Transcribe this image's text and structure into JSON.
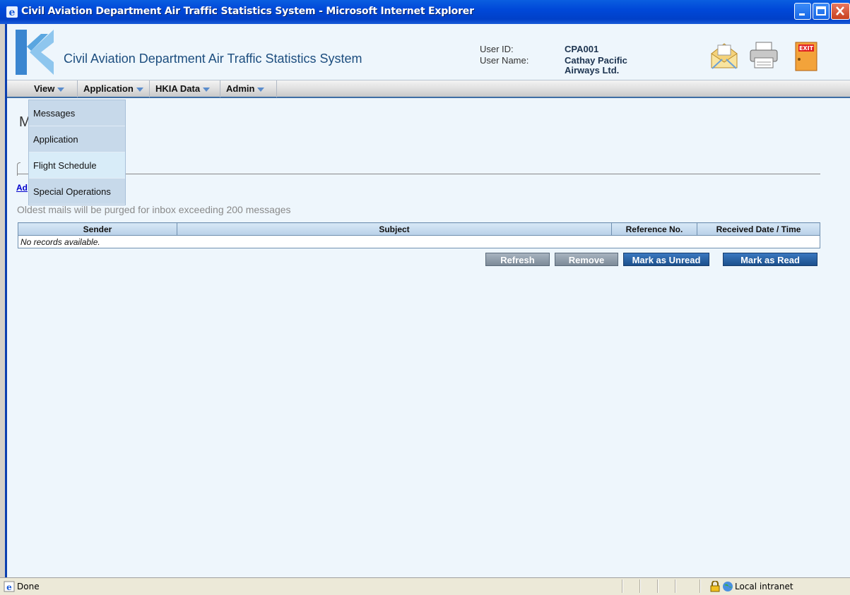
{
  "window": {
    "title": "Civil Aviation Department Air Traffic Statistics System - Microsoft Internet Explorer",
    "controls": [
      "minimize-icon",
      "maximize-icon",
      "close-icon"
    ]
  },
  "header": {
    "app_title": "Civil Aviation Department Air Traffic Statistics System",
    "user_id_label": "User ID:",
    "user_id_value": "CPA001",
    "user_name_label": "User Name:",
    "user_name_line1": "Cathay Pacific",
    "user_name_line2": "Airways Ltd.",
    "icons": [
      "mail-icon",
      "print-icon",
      "exit-icon"
    ],
    "exit_text": "EXIT"
  },
  "menu": {
    "items": [
      {
        "label": "View"
      },
      {
        "label": "Application"
      },
      {
        "label": "HKIA Data"
      },
      {
        "label": "Admin"
      }
    ],
    "dropdown": [
      "Messages",
      "Application",
      "Flight Schedule",
      "Special Operations"
    ]
  },
  "content": {
    "heading_fragment": "M",
    "link_fragment": "Ad",
    "purge_notice": "Oldest mails will be purged for inbox exceeding 200 messages",
    "table": {
      "headers": [
        "Sender",
        "Subject",
        "Reference No.",
        "Received Date / Time"
      ],
      "empty_text": "No records available."
    },
    "buttons": {
      "refresh": "Refresh",
      "remove": "Remove",
      "mark_unread": "Mark as Unread",
      "mark_read": "Mark as Read"
    }
  },
  "statusbar": {
    "status": "Done",
    "zone": "Local intranet"
  },
  "colors": {
    "titlebar": "#0048d8",
    "page_bg": "#eef6fc",
    "button_blue": "#1c508c",
    "button_grey": "#7c8a98"
  }
}
